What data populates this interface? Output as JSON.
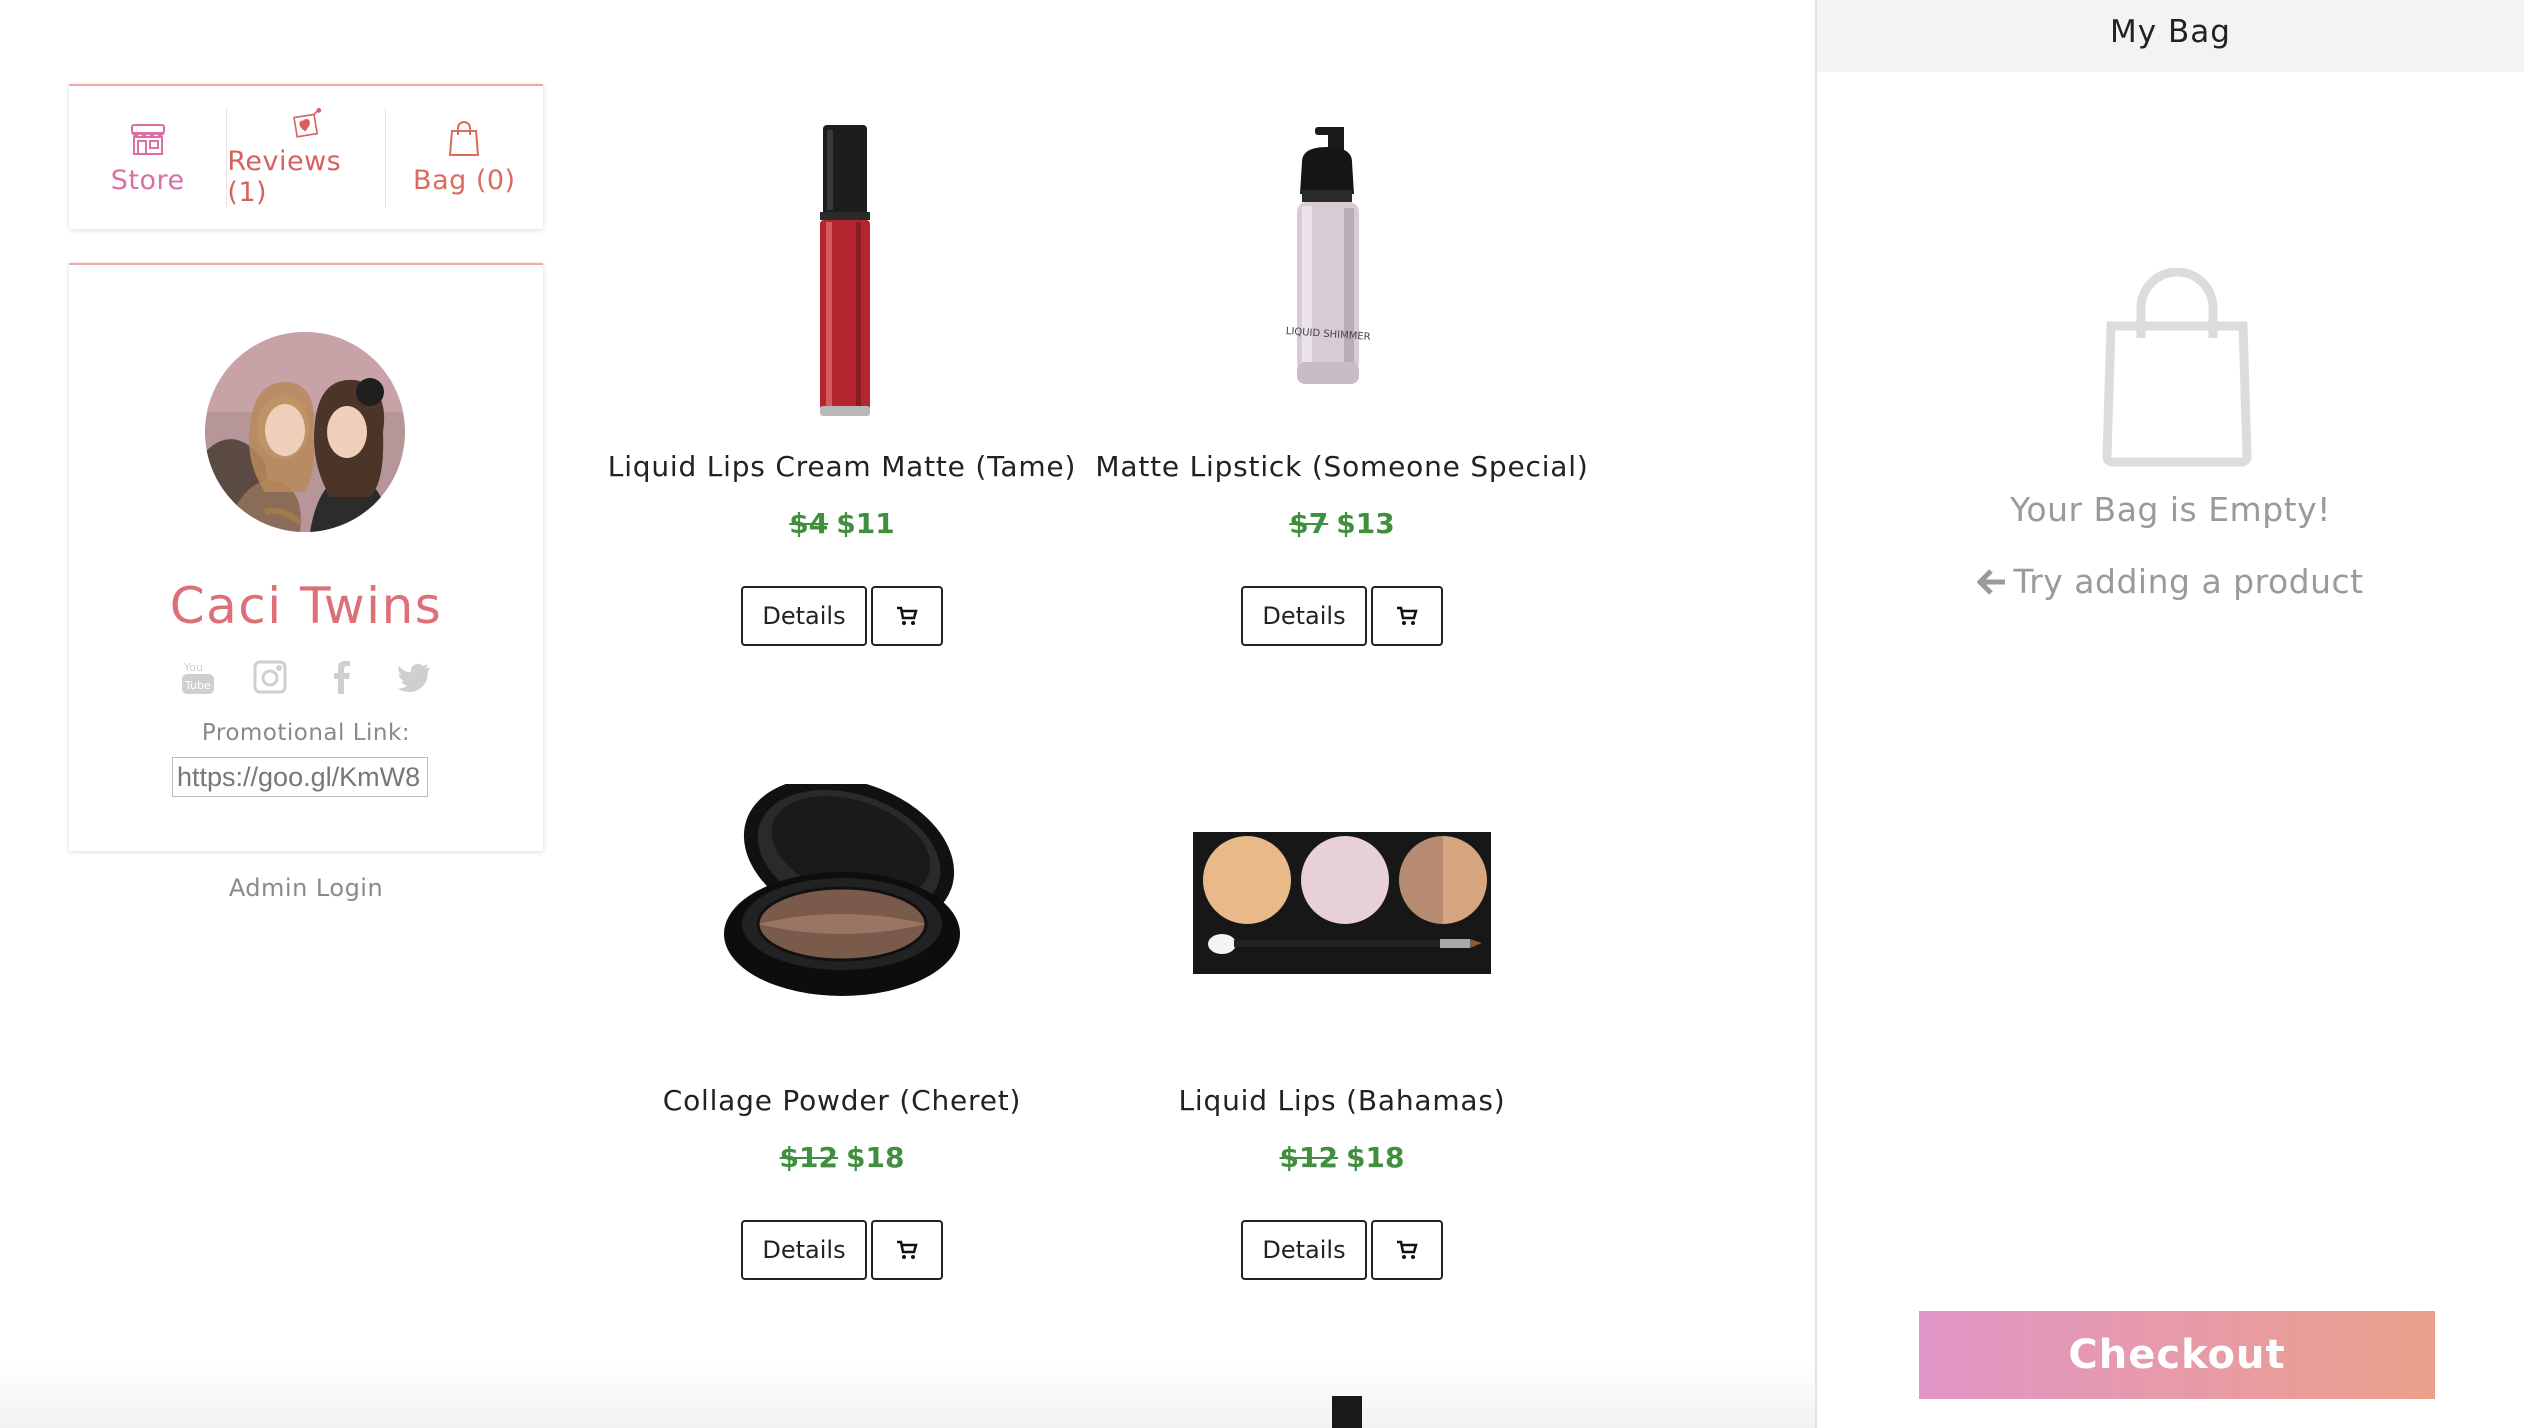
{
  "nav": {
    "store_label": "Store",
    "reviews_label": "Reviews (1)",
    "bag_label": "Bag (0)"
  },
  "profile": {
    "name": "Caci Twins",
    "promo_label": "Promotional Link:",
    "promo_value": "https://goo.gl/KmW8"
  },
  "admin_login": "Admin Login",
  "products": [
    {
      "name": "Liquid Lips Cream Matte (Tame)",
      "old_price": "$4",
      "price": "$11",
      "details_label": "Details"
    },
    {
      "name": "Matte Lipstick (Someone Special)",
      "old_price": "$7",
      "price": "$13",
      "details_label": "Details"
    },
    {
      "name": "Collage Powder (Cheret)",
      "old_price": "$12",
      "price": "$18",
      "details_label": "Details"
    },
    {
      "name": "Liquid Lips (Bahamas)",
      "old_price": "$12",
      "price": "$18",
      "details_label": "Details"
    }
  ],
  "bag": {
    "title": "My Bag",
    "empty_text": "Your Bag is Empty!",
    "try_text": "Try adding a product",
    "checkout_label": "Checkout"
  },
  "colors": {
    "accent_pink": "#dc6f78",
    "price_green": "#3f8f3f",
    "checkout_gradient_start": "#e196c8",
    "checkout_gradient_end": "#e9a08a"
  },
  "icons": [
    "store-icon",
    "heart-gift-icon",
    "shopping-bag-icon",
    "youtube-icon",
    "instagram-icon",
    "facebook-icon",
    "twitter-icon",
    "cart-icon",
    "arrow-left-icon"
  ]
}
